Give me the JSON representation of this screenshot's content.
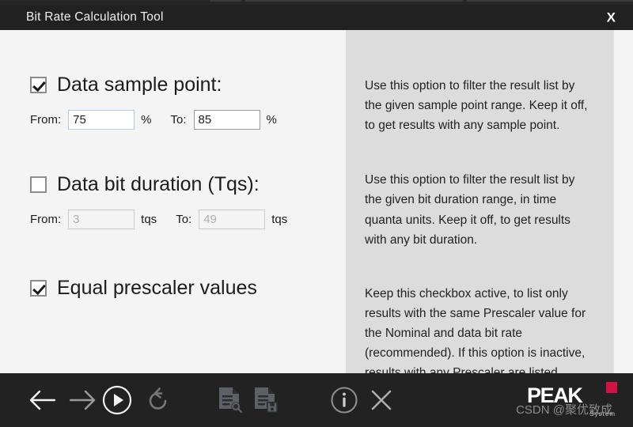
{
  "window": {
    "title": "Bit Rate Calculation Tool",
    "close_label": "X"
  },
  "options": [
    {
      "id": "data-sample-point",
      "label": "Data sample point:",
      "checked": true,
      "enabled": true,
      "from_label": "From:",
      "from_value": "75",
      "from_unit": "%",
      "to_label": "To:",
      "to_value": "85",
      "to_unit": "%",
      "help": "Use this option to filter the result list by the given sample point range. Keep it off, to get results with any sample point."
    },
    {
      "id": "data-bit-duration",
      "label": "Data bit duration (Tqs):",
      "checked": false,
      "enabled": false,
      "from_label": "From:",
      "from_value": "3",
      "from_unit": "tqs",
      "to_label": "To:",
      "to_value": "49",
      "to_unit": "tqs",
      "help": "Use this option to filter the result list by the given bit duration range, in time quanta units. Keep it off, to get results with any bit duration."
    },
    {
      "id": "equal-prescaler-values",
      "label": "Equal prescaler values",
      "checked": true,
      "enabled": true,
      "help": "Keep this checkbox active, to list only results with the same Prescaler value for the Nominal and data bit rate (recommended). If this option is inactive, results with any Prescaler are listed."
    }
  ],
  "toolbar": {
    "items": [
      {
        "name": "back-arrow-icon",
        "state": "active"
      },
      {
        "name": "forward-arrow-icon",
        "state": "dim"
      },
      {
        "name": "run-play-icon",
        "state": "active"
      },
      {
        "name": "reset-undo-icon",
        "state": "dim"
      },
      {
        "name": "load-document-icon",
        "state": "dim"
      },
      {
        "name": "save-document-icon",
        "state": "dim"
      },
      {
        "name": "info-icon",
        "state": "dim"
      },
      {
        "name": "close-x-icon",
        "state": "dim"
      }
    ]
  },
  "branding": {
    "logo_text": "PEAK",
    "logo_sub": "System",
    "accent_color": "#d31145",
    "watermark": "CSDN @聚优致成"
  },
  "colors": {
    "titlebar_bg": "#212121",
    "toolbar_bg": "#222222",
    "left_panel_bg": "#f4f4f4",
    "help_panel_bg": "#dcdcdc",
    "focus_border": "#aacdf0"
  }
}
